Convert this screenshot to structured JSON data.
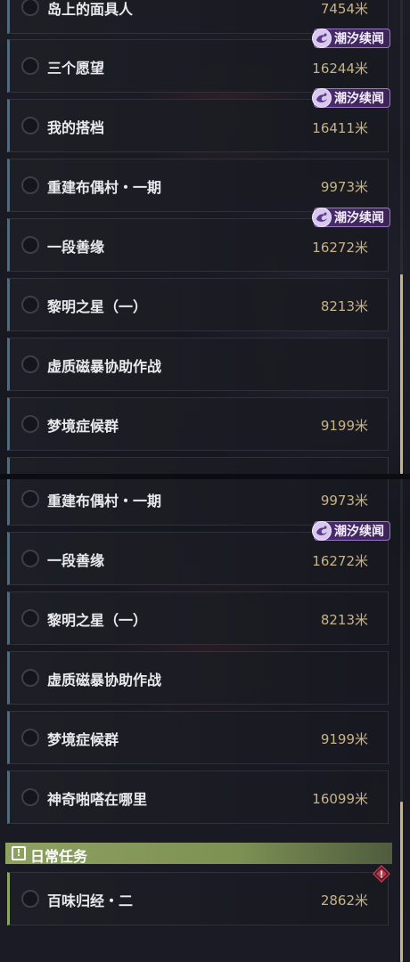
{
  "top_list": {
    "items": [
      {
        "name": "岛上的面具人",
        "distance": "7454米",
        "tag": null
      },
      {
        "name": "三个愿望",
        "distance": "16244米",
        "tag": "潮汐续闻"
      },
      {
        "name": "我的搭档",
        "distance": "16411米",
        "tag": "潮汐续闻"
      },
      {
        "name": "重建布偶村・一期",
        "distance": "9973米",
        "tag": null
      },
      {
        "name": "一段善缘",
        "distance": "16272米",
        "tag": "潮汐续闻"
      },
      {
        "name": "黎明之星（一）",
        "distance": "8213米",
        "tag": null
      },
      {
        "name": "虚质磁暴协助作战",
        "distance": "",
        "tag": null
      },
      {
        "name": "梦境症候群",
        "distance": "9199米",
        "tag": null
      }
    ]
  },
  "bottom_list": {
    "items": [
      {
        "name": "重建布偶村・一期",
        "distance": "9973米",
        "tag": null
      },
      {
        "name": "一段善缘",
        "distance": "16272米",
        "tag": "潮汐续闻"
      },
      {
        "name": "黎明之星（一）",
        "distance": "8213米",
        "tag": null
      },
      {
        "name": "虚质磁暴协助作战",
        "distance": "",
        "tag": null
      },
      {
        "name": "梦境症候群",
        "distance": "9199米",
        "tag": null
      },
      {
        "name": "神奇啪嗒在哪里",
        "distance": "16099米",
        "tag": null
      }
    ]
  },
  "daily_section": {
    "title": "日常任务",
    "items": [
      {
        "name": "百味归经・二",
        "distance": "2862米"
      }
    ]
  },
  "colors": {
    "accent_gold": "#c8b386",
    "tag_purple": "#4b2e6e",
    "daily_green": "#8ea161",
    "alert_red": "#c0384a"
  },
  "icons": {
    "tag": "wave-swirl-icon",
    "section": "exclamation-icon",
    "alert": "diamond-alert-icon",
    "radio": "radio-circle-icon"
  }
}
